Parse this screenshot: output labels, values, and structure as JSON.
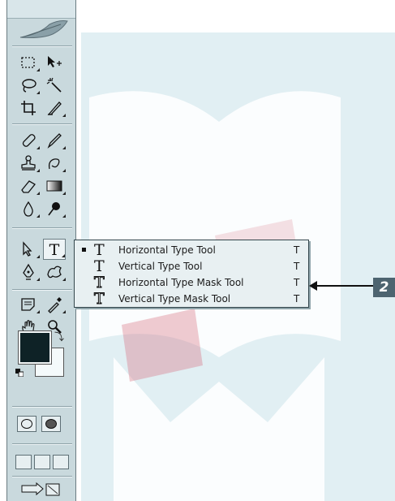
{
  "toolbox": {
    "tools": [
      {
        "name": "rectangular-marquee-tool",
        "icon": "marquee-icon"
      },
      {
        "name": "move-tool",
        "icon": "move-icon"
      },
      {
        "name": "lasso-tool",
        "icon": "lasso-icon"
      },
      {
        "name": "magic-wand-tool",
        "icon": "magic-wand-icon"
      },
      {
        "name": "crop-tool",
        "icon": "crop-icon"
      },
      {
        "name": "slice-tool",
        "icon": "slice-icon"
      },
      {
        "name": "healing-brush-tool",
        "icon": "bandage-icon"
      },
      {
        "name": "brush-tool",
        "icon": "brush-icon"
      },
      {
        "name": "clone-stamp-tool",
        "icon": "stamp-icon"
      },
      {
        "name": "history-brush-tool",
        "icon": "history-brush-icon"
      },
      {
        "name": "eraser-tool",
        "icon": "eraser-icon"
      },
      {
        "name": "gradient-tool",
        "icon": "gradient-icon"
      },
      {
        "name": "blur-tool",
        "icon": "drop-icon"
      },
      {
        "name": "dodge-tool",
        "icon": "dodge-icon"
      },
      {
        "name": "path-selection-tool",
        "icon": "arrow-icon"
      },
      {
        "name": "type-tool",
        "icon": "type-icon",
        "active": true
      },
      {
        "name": "pen-tool",
        "icon": "pen-icon"
      },
      {
        "name": "custom-shape-tool",
        "icon": "shape-icon"
      },
      {
        "name": "notes-tool",
        "icon": "notes-icon"
      },
      {
        "name": "eyedropper-tool",
        "icon": "eyedropper-icon"
      },
      {
        "name": "hand-tool",
        "icon": "hand-icon"
      },
      {
        "name": "zoom-tool",
        "icon": "zoom-icon"
      }
    ],
    "colors": {
      "foreground": "#0e2226",
      "background": "#f4fafb"
    }
  },
  "flyout": {
    "items": [
      {
        "icon": "T",
        "label": "Horizontal Type Tool",
        "key": "T",
        "selected": true
      },
      {
        "icon": "T",
        "label": "Vertical Type Tool",
        "key": "T"
      },
      {
        "icon": "T",
        "label": "Horizontal Type Mask Tool",
        "key": "T"
      },
      {
        "icon": "T",
        "label": "Vertical Type Mask Tool",
        "key": "T"
      }
    ]
  },
  "callout": {
    "number": "2"
  },
  "accent": "#4d6470"
}
